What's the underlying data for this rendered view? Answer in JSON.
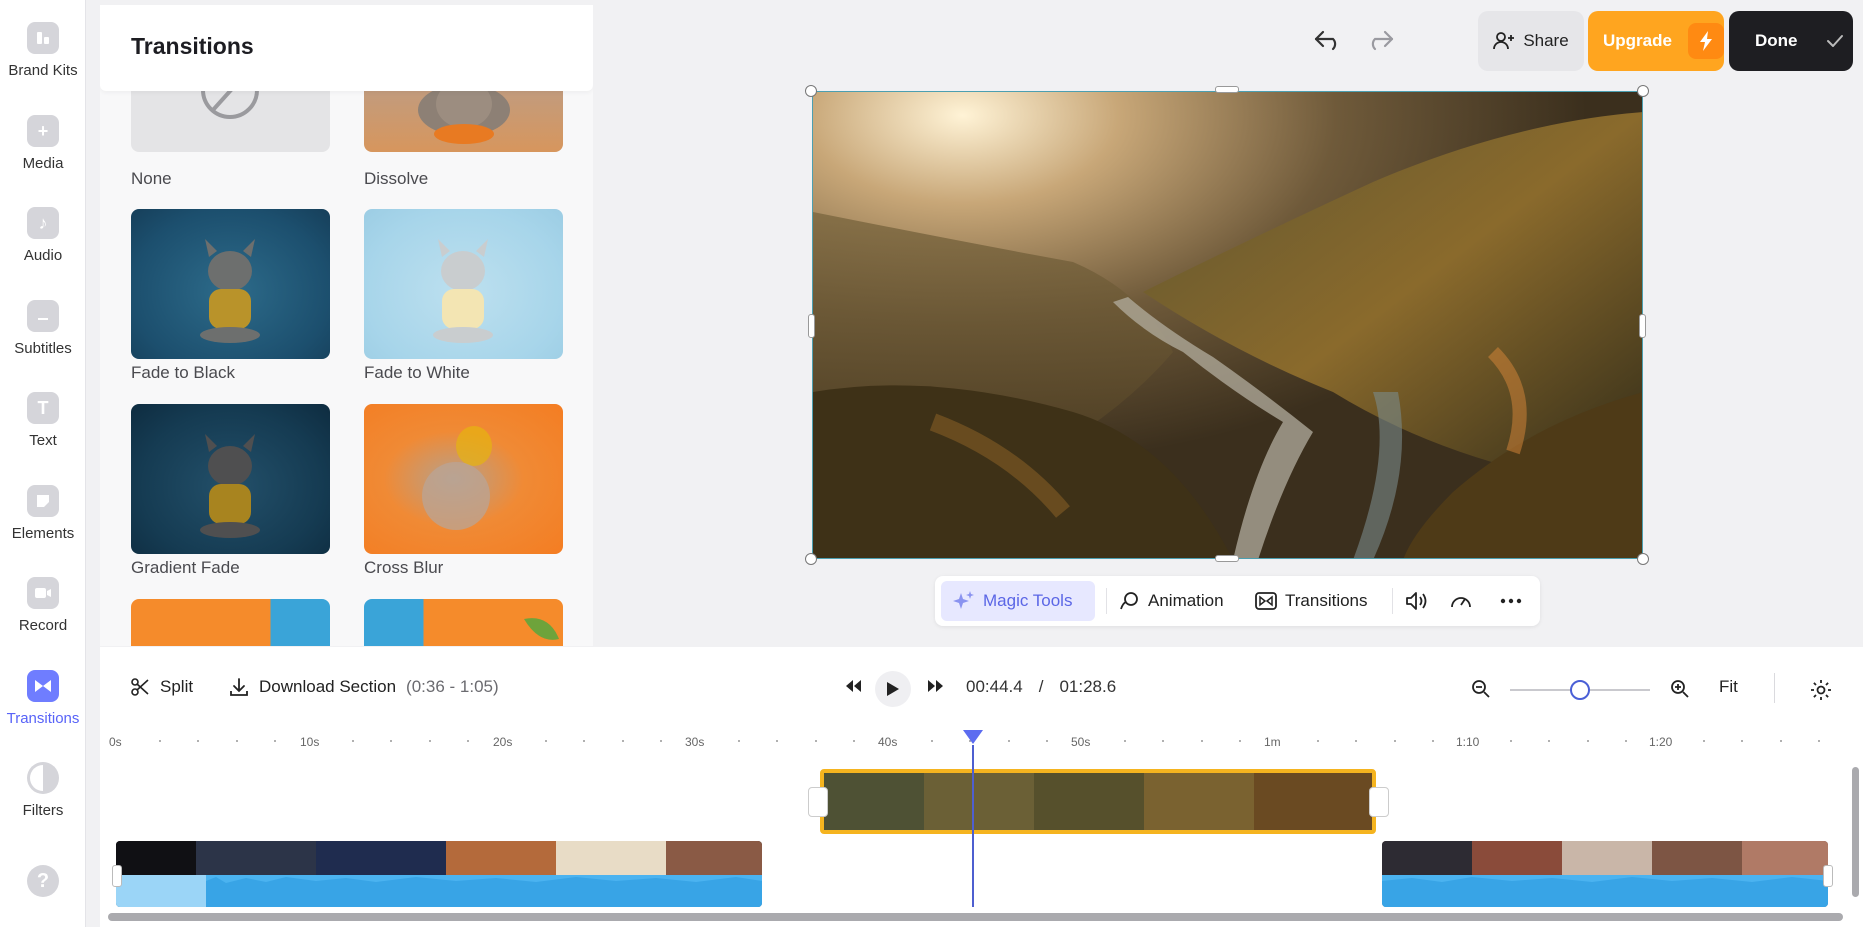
{
  "sidebar": {
    "items": [
      {
        "label": "Brand Kits",
        "icon": "brand-kits-icon"
      },
      {
        "label": "Media",
        "icon": "plus-icon"
      },
      {
        "label": "Audio",
        "icon": "music-note-icon"
      },
      {
        "label": "Subtitles",
        "icon": "subtitles-icon"
      },
      {
        "label": "Text",
        "icon": "text-icon"
      },
      {
        "label": "Elements",
        "icon": "elements-icon"
      },
      {
        "label": "Record",
        "icon": "record-icon"
      },
      {
        "label": "Transitions",
        "icon": "transitions-icon",
        "active": true
      },
      {
        "label": "Filters",
        "icon": "filters-icon"
      }
    ],
    "help_icon": "?"
  },
  "panel": {
    "title": "Transitions",
    "items": [
      {
        "label": "None"
      },
      {
        "label": "Dissolve"
      },
      {
        "label": "Fade to Black"
      },
      {
        "label": "Fade to White"
      },
      {
        "label": "Gradient Fade"
      },
      {
        "label": "Cross Blur"
      }
    ]
  },
  "header": {
    "share_label": "Share",
    "upgrade_label": "Upgrade",
    "done_label": "Done"
  },
  "toolbar": {
    "magic_tools": "Magic Tools",
    "animation": "Animation",
    "transitions": "Transitions"
  },
  "timeline": {
    "split_label": "Split",
    "download_label": "Download Section",
    "download_range": "(0:36 - 1:05)",
    "current_time": "00:44.4",
    "separator": "/",
    "total_time": "01:28.6",
    "fit_label": "Fit",
    "ruler": [
      "0s",
      "10s",
      "20s",
      "30s",
      "40s",
      "50s",
      "1m",
      "1:10",
      "1:20"
    ],
    "zoom_level": 0.5
  },
  "colors": {
    "accent": "#5863f8",
    "upgrade": "#ffa51f",
    "selected_clip": "#f5b41f",
    "audio_wave": "#4bb3f0"
  }
}
